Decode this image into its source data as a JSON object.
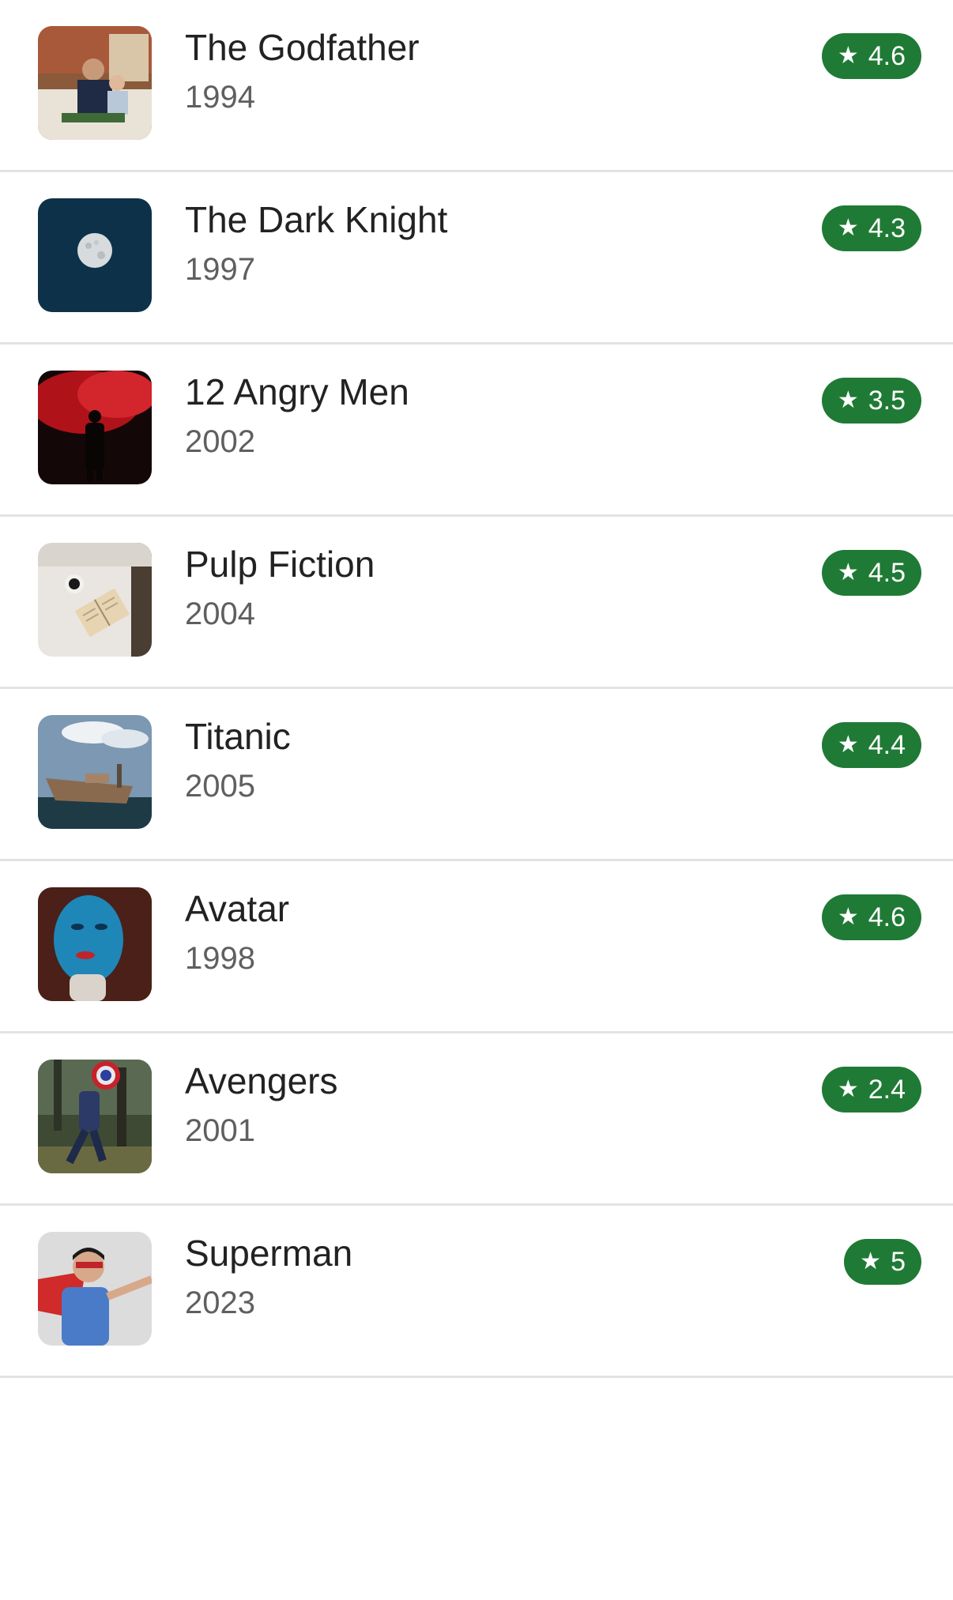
{
  "movies": [
    {
      "title": "The Godfather",
      "year": "1994",
      "rating": "4.6",
      "thumb_icon": "family-photo-icon"
    },
    {
      "title": "The Dark Knight",
      "year": "1997",
      "rating": "4.3",
      "thumb_icon": "moon-icon"
    },
    {
      "title": "12 Angry Men",
      "year": "2002",
      "rating": "3.5",
      "thumb_icon": "silhouette-red-smoke-icon"
    },
    {
      "title": "Pulp Fiction",
      "year": "2004",
      "rating": "4.5",
      "thumb_icon": "book-coffee-icon"
    },
    {
      "title": "Titanic",
      "year": "2005",
      "rating": "4.4",
      "thumb_icon": "shipwreck-icon"
    },
    {
      "title": "Avatar",
      "year": "1998",
      "rating": "4.6",
      "thumb_icon": "blue-face-icon"
    },
    {
      "title": "Avengers",
      "year": "2001",
      "rating": "2.4",
      "thumb_icon": "shield-hero-icon"
    },
    {
      "title": "Superman",
      "year": "2023",
      "rating": "5",
      "thumb_icon": "caped-man-icon"
    }
  ],
  "colors": {
    "badge": "#1f7a35",
    "divider": "#e3e3e3",
    "title": "#222222",
    "year": "#5f5f5f"
  },
  "icons": {
    "rating": "star-icon"
  }
}
